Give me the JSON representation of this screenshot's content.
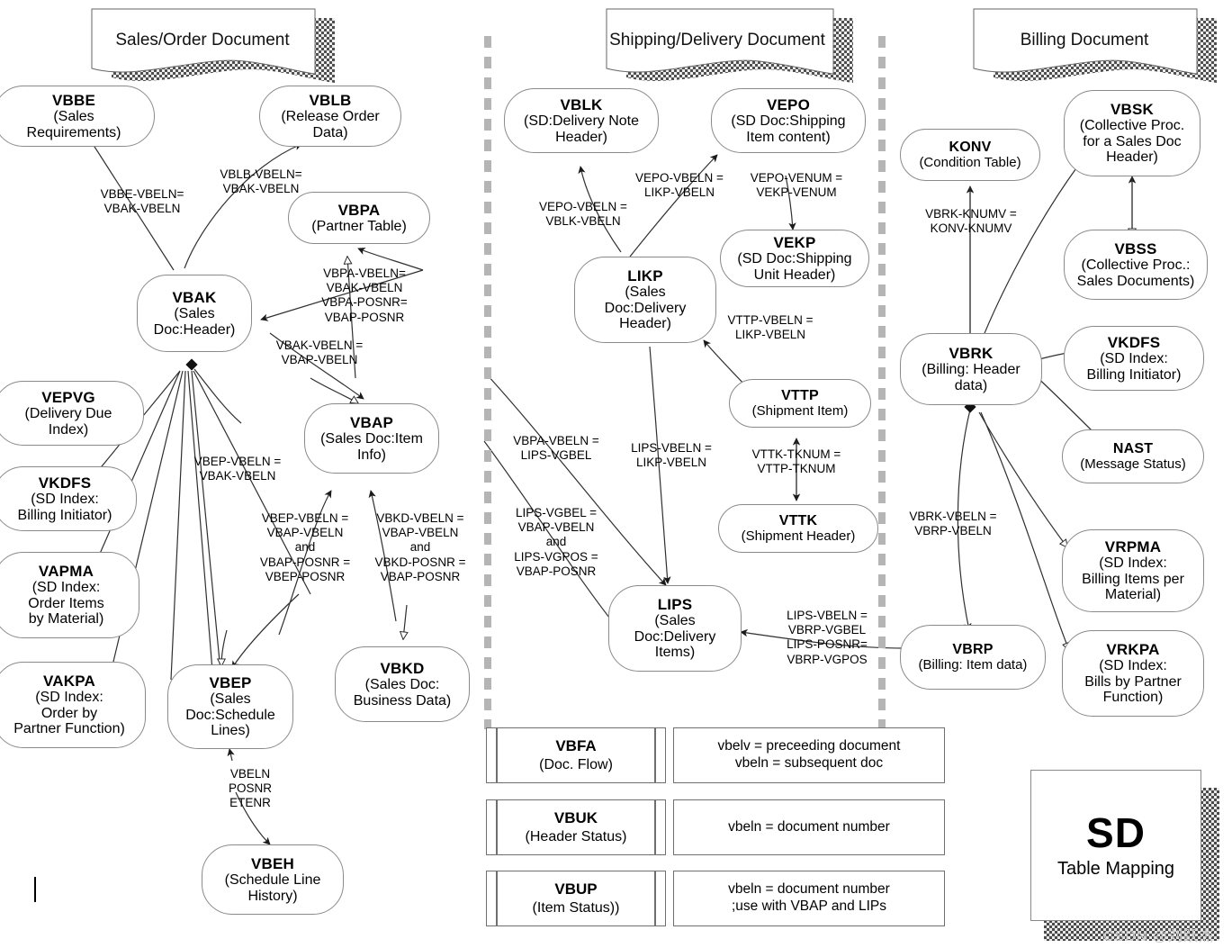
{
  "title_plate": {
    "big": "SD",
    "sub": "Table Mapping"
  },
  "watermark": "CSDN @刘跃杰",
  "banners": [
    {
      "id": "sales-order",
      "label": "Sales/Order Document"
    },
    {
      "id": "shipping-delivery",
      "label": "Shipping/Delivery Document"
    },
    {
      "id": "billing",
      "label": "Billing Document"
    }
  ],
  "nodes": [
    {
      "id": "VBBE",
      "name": "VBBE",
      "desc": "(Sales\nRequirements)"
    },
    {
      "id": "VBLB",
      "name": "VBLB",
      "desc": "(Release Order\nData)"
    },
    {
      "id": "VBPA",
      "name": "VBPA",
      "desc": "(Partner Table)"
    },
    {
      "id": "VBAK",
      "name": "VBAK",
      "desc": "(Sales\nDoc:Header)"
    },
    {
      "id": "VEPVG",
      "name": "VEPVG",
      "desc": "(Delivery Due\nIndex)"
    },
    {
      "id": "VKDFS_L",
      "name": "VKDFS",
      "desc": "(SD Index:\nBilling Initiator)"
    },
    {
      "id": "VAPMA",
      "name": "VAPMA",
      "desc": "(SD Index:\nOrder Items\nby Material)"
    },
    {
      "id": "VAKPA",
      "name": "VAKPA",
      "desc": "(SD Index:\nOrder by\nPartner Function)"
    },
    {
      "id": "VBAP",
      "name": "VBAP",
      "desc": "(Sales Doc:Item\nInfo)"
    },
    {
      "id": "VBEP",
      "name": "VBEP",
      "desc": "(Sales\nDoc:Schedule\nLines)"
    },
    {
      "id": "VBKD",
      "name": "VBKD",
      "desc": "(Sales Doc:\nBusiness Data)"
    },
    {
      "id": "VBEH",
      "name": "VBEH",
      "desc": "(Schedule Line\nHistory)"
    },
    {
      "id": "VBLK",
      "name": "VBLK",
      "desc": "(SD:Delivery Note\nHeader)"
    },
    {
      "id": "VEPO",
      "name": "VEPO",
      "desc": "(SD Doc:Shipping\nItem content)"
    },
    {
      "id": "VEKP",
      "name": "VEKP",
      "desc": "(SD Doc:Shipping\nUnit Header)"
    },
    {
      "id": "LIKP",
      "name": "LIKP",
      "desc": "(Sales\nDoc:Delivery\nHeader)"
    },
    {
      "id": "VTTP",
      "name": "VTTP",
      "desc": "(Shipment Item)"
    },
    {
      "id": "VTTK",
      "name": "VTTK",
      "desc": "(Shipment Header)"
    },
    {
      "id": "LIPS",
      "name": "LIPS",
      "desc": "(Sales\nDoc:Delivery\nItems)"
    },
    {
      "id": "KONV",
      "name": "KONV",
      "desc": "(Condition Table)"
    },
    {
      "id": "VBSK",
      "name": "VBSK",
      "desc": "(Collective Proc.\nfor a Sales Doc\nHeader)"
    },
    {
      "id": "VBSS",
      "name": "VBSS",
      "desc": "(Collective Proc.:\nSales Documents)"
    },
    {
      "id": "VKDFS_R",
      "name": "VKDFS",
      "desc": "(SD Index:\nBilling Initiator)"
    },
    {
      "id": "VBRK",
      "name": "VBRK",
      "desc": "(Billing: Header\ndata)"
    },
    {
      "id": "NAST",
      "name": "NAST",
      "desc": "(Message Status)"
    },
    {
      "id": "VRPMA",
      "name": "VRPMA",
      "desc": "(SD Index:\nBilling Items per\nMaterial)"
    },
    {
      "id": "VRKPA",
      "name": "VRKPA",
      "desc": "(SD Index:\nBills by Partner\nFunction)"
    },
    {
      "id": "VBRP",
      "name": "VBRP",
      "desc": "(Billing: Item data)"
    }
  ],
  "edge_labels": [
    {
      "id": "vbbe-vbak",
      "text": "VBBE-VBELN=\nVBAK-VBELN"
    },
    {
      "id": "vblb-vbak",
      "text": "VBLB-VBELN=\nVBAK-VBELN"
    },
    {
      "id": "vbpa-vbak",
      "text": "VBPA-VBELN=\nVBAK-VBELN\nVBPA-POSNR=\nVBAP-POSNR"
    },
    {
      "id": "vbak-vbap",
      "text": "VBAK-VBELN =\nVBAP-VBELN"
    },
    {
      "id": "vbep-vbak",
      "text": "VBEP-VBELN =\nVBAK-VBELN"
    },
    {
      "id": "vbep-vbap",
      "text": "VBEP-VBELN =\nVBAP-VBELN\nand\nVBAP-POSNR =\nVBEP-POSNR"
    },
    {
      "id": "vbkd-vbap",
      "text": "VBKD-VBELN =\nVBAP-VBELN\nand\nVBKD-POSNR =\nVBAP-POSNR"
    },
    {
      "id": "vbeh-vbep",
      "text": "VBELN\nPOSNR\nETENR"
    },
    {
      "id": "vepo-vblk",
      "text": "VEPO-VBELN =\nVBLK-VBELN"
    },
    {
      "id": "vepo-likp",
      "text": "VEPO-VBELN =\nLIKP-VBELN"
    },
    {
      "id": "vepo-vekp",
      "text": "VEPO-VENUM =\nVEKP-VENUM"
    },
    {
      "id": "vttp-likp",
      "text": "VTTP-VBELN =\nLIKP-VBELN"
    },
    {
      "id": "vttk-vttp",
      "text": "VTTK-TKNUM =\nVTTP-TKNUM"
    },
    {
      "id": "vbpa-lips",
      "text": "VBPA-VBELN =\nLIPS-VGBEL"
    },
    {
      "id": "lips-likp",
      "text": "LIPS-VBELN =\nLIKP-VBELN"
    },
    {
      "id": "lips-vbap",
      "text": "LIPS-VGBEL =\nVBAP-VBELN\nand\nLIPS-VGPOS =\nVBAP-POSNR"
    },
    {
      "id": "lips-vbrp",
      "text": "LIPS-VBELN =\nVBRP-VGBEL\nLIPS-POSNR=\nVBRP-VGPOS"
    },
    {
      "id": "vbrk-konv",
      "text": "VBRK-KNUMV =\nKONV-KNUMV"
    },
    {
      "id": "vbrk-vbrp",
      "text": "VBRK-VBELN =\nVBRP-VBELN"
    }
  ],
  "legend": [
    {
      "id": "VBFA",
      "name": "VBFA",
      "desc": "(Doc. Flow)",
      "text": "vbelv = preceeding document\nvbeln = subsequent doc"
    },
    {
      "id": "VBUK",
      "name": "VBUK",
      "desc": "(Header Status)",
      "text": "vbeln = document number"
    },
    {
      "id": "VBUP",
      "name": "VBUP",
      "desc": "(Item Status))",
      "text": "vbeln = document number\n;use with VBAP and LIPs"
    }
  ],
  "colors": {
    "node_border": "#8a8a8a",
    "line": "#3a3a3a",
    "divider": "#b5b5b5",
    "text": "#000000"
  }
}
